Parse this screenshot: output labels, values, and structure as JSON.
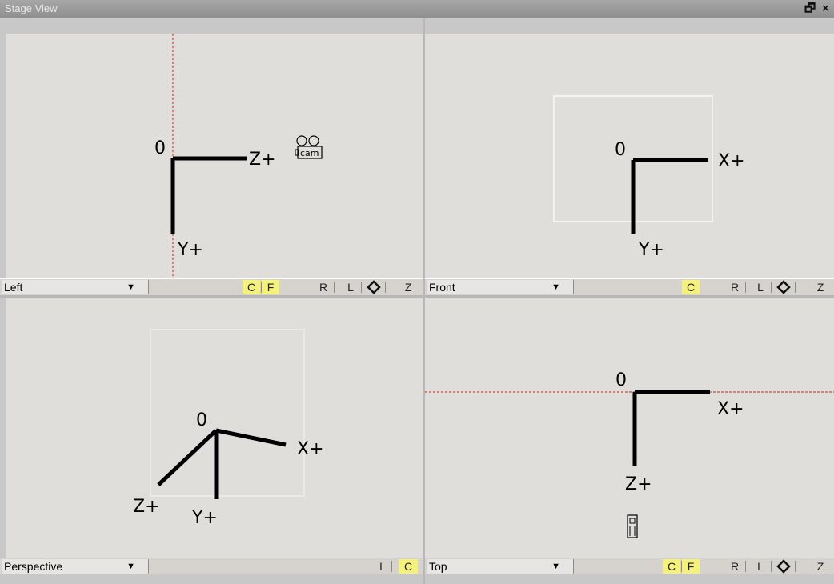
{
  "window": {
    "title": "Stage View",
    "restore_icon": "restore-icon",
    "close_icon": "close-icon"
  },
  "panes": {
    "left": {
      "view": "Left",
      "buttons": {
        "c": "C",
        "f": "F",
        "r": "R",
        "l": "L",
        "z": "Z"
      },
      "axis": {
        "origin": "0",
        "h": "Z+",
        "v": "Y+",
        "cam": "cam"
      }
    },
    "front": {
      "view": "Front",
      "buttons": {
        "c": "C",
        "r": "R",
        "l": "L",
        "z": "Z"
      },
      "axis": {
        "origin": "0",
        "h": "X+",
        "v": "Y+"
      }
    },
    "perspective": {
      "view": "Perspective",
      "buttons": {
        "i": "I",
        "c": "C"
      },
      "axis": {
        "origin": "0",
        "x": "X+",
        "y": "Y+",
        "z": "Z+"
      }
    },
    "top": {
      "view": "Top",
      "buttons": {
        "c": "C",
        "f": "F",
        "r": "R",
        "l": "L",
        "z": "Z"
      },
      "axis": {
        "origin": "0",
        "h": "X+",
        "v": "Z+"
      }
    }
  },
  "colors": {
    "highlight": "#f4f27a",
    "guide": "#cc2222",
    "viewport_bg": "#e0dedb"
  }
}
